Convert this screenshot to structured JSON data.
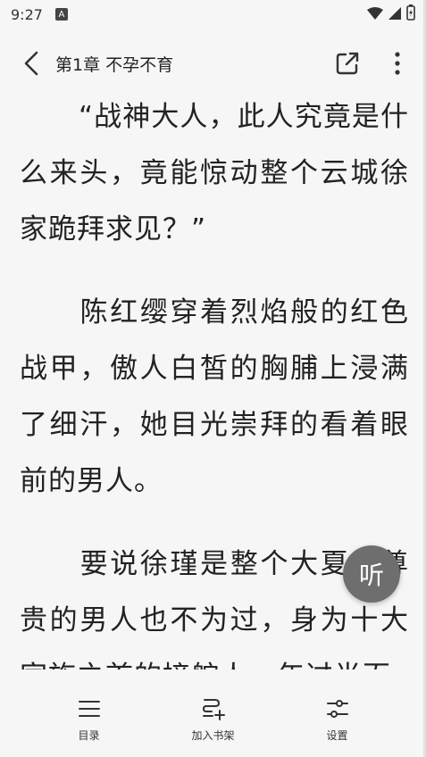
{
  "status_bar": {
    "time": "9:27",
    "badge": "A"
  },
  "app_bar": {
    "chapter_title": "第1章 不孕不育"
  },
  "reader": {
    "paragraphs": [
      "“战神大人，此人究竟是什么来头，竟能惊动整个云城徐家跪拜求见？”",
      "陈红缨穿着烈焰般的红色战甲，傲人白皙的胸脯上浸满了细汗，她目光崇拜的看着眼前的男人。",
      "要说徐瑾是整个大夏最尊贵的男人也不为过，身为十大家族之首的接舵人，年过半百"
    ]
  },
  "listen_button": {
    "label": "听"
  },
  "bottom_nav": {
    "items": [
      {
        "label": "目录",
        "icon": "list-icon"
      },
      {
        "label": "加入书架",
        "icon": "bookshelf-add-icon"
      },
      {
        "label": "设置",
        "icon": "sliders-icon"
      }
    ]
  },
  "colors": {
    "background": "#f6f6f6",
    "text": "#222222",
    "fab": "#6e6e6e",
    "marker": "#e8c000"
  }
}
